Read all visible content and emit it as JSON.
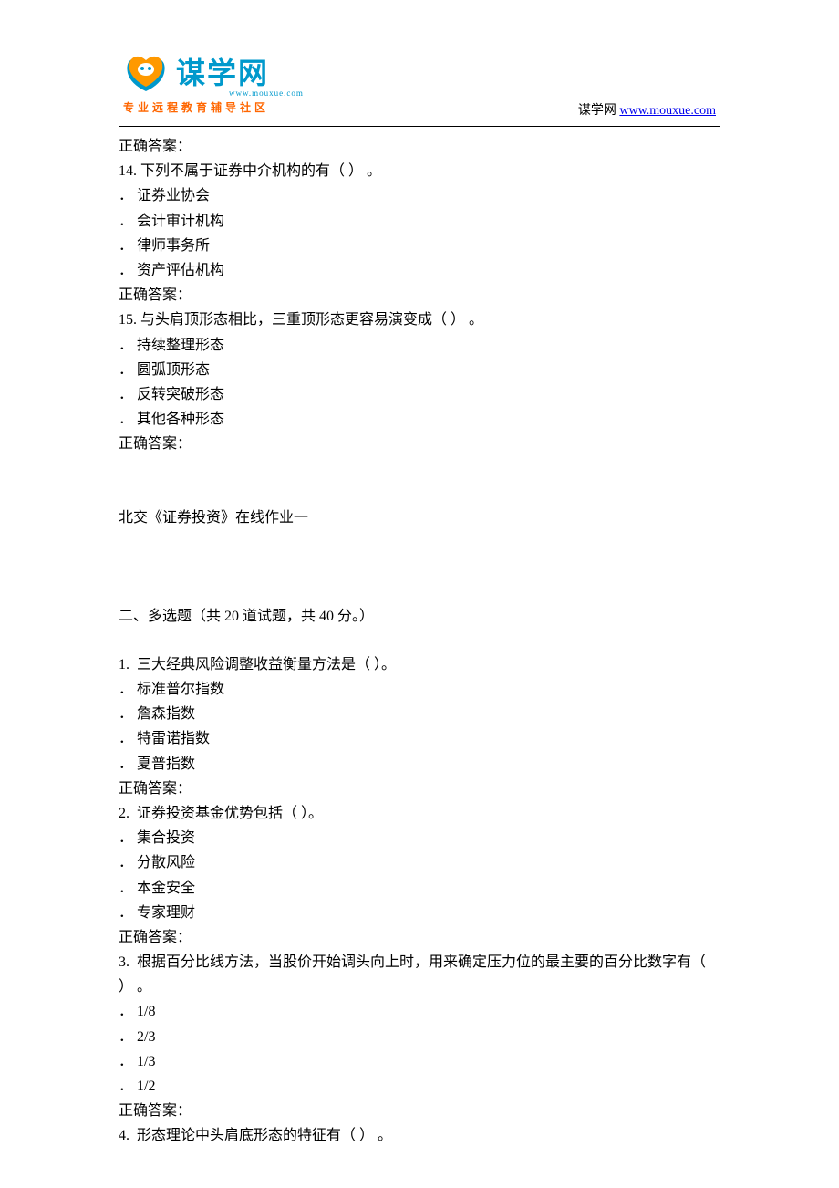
{
  "header": {
    "brand_main": "谋学网",
    "brand_sub": "www.mouxue.com",
    "tagline": "专业远程教育辅导社区",
    "right_label": "谋学网 ",
    "right_link": "www.mouxue.com"
  },
  "body": {
    "ans_prefix_top": "正确答案：",
    "q14": {
      "num": "14.",
      "text": " 下列不属于证券中介机构的有（ ） 。",
      "opts": [
        "． 证券业协会",
        "． 会计审计机构",
        "． 律师事务所",
        "． 资产评估机构"
      ],
      "ans": "正确答案："
    },
    "q15": {
      "num": "15.",
      "text": " 与头肩顶形态相比，三重顶形态更容易演变成（ ） 。",
      "opts": [
        "． 持续整理形态",
        "． 圆弧顶形态",
        "． 反转突破形态",
        "． 其他各种形态"
      ],
      "ans": "正确答案："
    },
    "section_title": "北交《证券投资》在线作业一",
    "section2_heading": "二、多选题（共 20 道试题，共 40 分。）",
    "mq1": {
      "num": "1.",
      "text": "  三大经典风险调整收益衡量方法是（ ）。",
      "opts": [
        "． 标准普尔指数",
        "． 詹森指数",
        "． 特雷诺指数",
        "． 夏普指数"
      ],
      "ans": "正确答案："
    },
    "mq2": {
      "num": "2.",
      "text": "  证券投资基金优势包括（ ）。",
      "opts": [
        "． 集合投资",
        "． 分散风险",
        "． 本金安全",
        "． 专家理财"
      ],
      "ans": "正确答案："
    },
    "mq3": {
      "num": "3.",
      "text": "  根据百分比线方法，当股价开始调头向上时，用来确定压力位的最主要的百分比数字有（ ） 。",
      "opts": [
        "． 1/8",
        "． 2/3",
        "． 1/3",
        "． 1/2"
      ],
      "ans": "正确答案："
    },
    "mq4": {
      "num": "4.",
      "text": "  形态理论中头肩底形态的特征有（ ） 。"
    }
  }
}
